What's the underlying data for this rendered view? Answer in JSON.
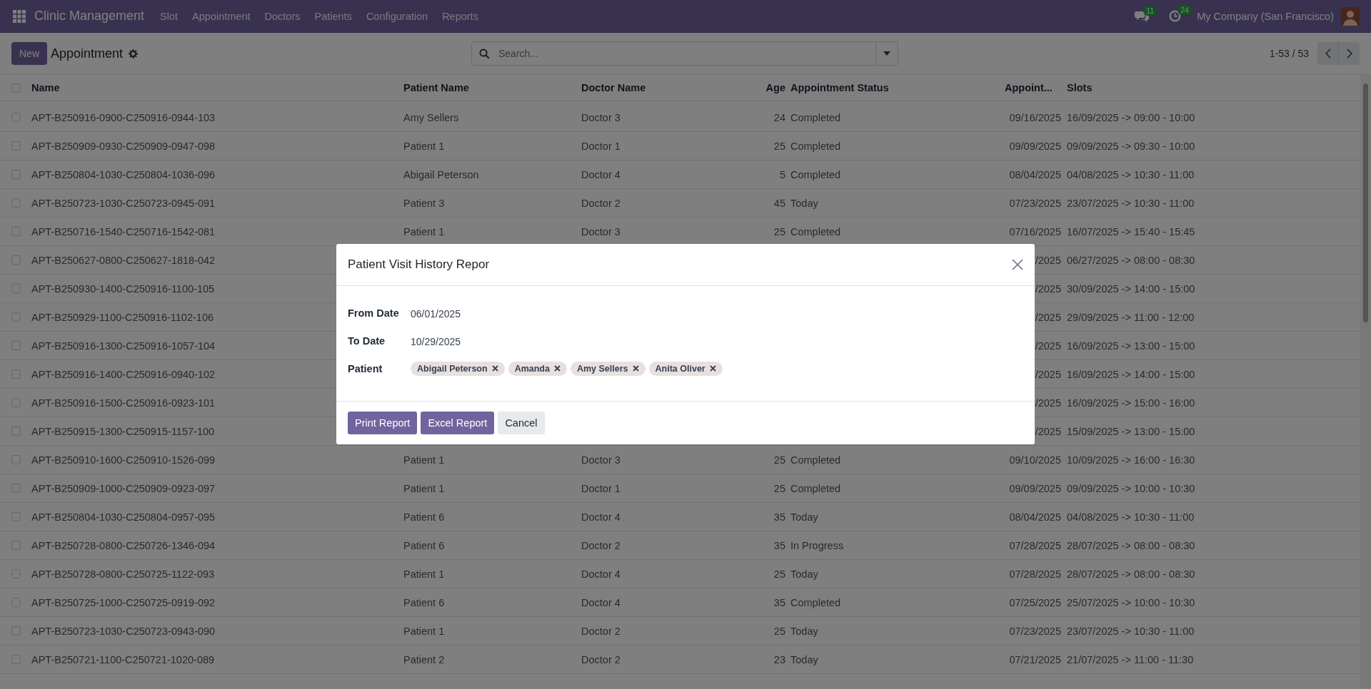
{
  "navbar": {
    "app_name": "Clinic Management",
    "menu": [
      "Slot",
      "Appointment",
      "Doctors",
      "Patients",
      "Configuration",
      "Reports"
    ],
    "messages_count": "11",
    "activities_count": "24",
    "company": "My Company (San Francisco)"
  },
  "control_panel": {
    "new_button": "New",
    "title": "Appointment",
    "search": {
      "placeholder": "Search..."
    },
    "pager": "1-53 / 53"
  },
  "table": {
    "all_selected": false,
    "columns": [
      {
        "label": "Name",
        "kind": "text"
      },
      {
        "label": "Patient Name",
        "kind": "text"
      },
      {
        "label": "Doctor Name",
        "kind": "text"
      },
      {
        "label": "Age",
        "kind": "number"
      },
      {
        "label": "Appointment Status",
        "kind": "text"
      },
      {
        "label": "Appoint...",
        "kind": "date"
      },
      {
        "label": "Slots",
        "kind": "text"
      }
    ],
    "rows": [
      {
        "selected": false,
        "name": "APT-B250916-0900-C250916-0944-103",
        "patient": "Amy Sellers",
        "doctor": "Doctor 3",
        "age": "24",
        "status": "Completed",
        "date": "09/16/2025",
        "slots": "16/09/2025 -> 09:00 - 10:00"
      },
      {
        "selected": false,
        "name": "APT-B250909-0930-C250909-0947-098",
        "patient": "Patient 1",
        "doctor": "Doctor 1",
        "age": "25",
        "status": "Completed",
        "date": "09/09/2025",
        "slots": "09/09/2025 -> 09:30 - 10:00"
      },
      {
        "selected": false,
        "name": "APT-B250804-1030-C250804-1036-096",
        "patient": "Abigail Peterson",
        "doctor": "Doctor 4",
        "age": "5",
        "status": "Completed",
        "date": "08/04/2025",
        "slots": "04/08/2025 -> 10:30 - 11:00"
      },
      {
        "selected": false,
        "name": "APT-B250723-1030-C250723-0945-091",
        "patient": "Patient 3",
        "doctor": "Doctor 2",
        "age": "45",
        "status": "Today",
        "date": "07/23/2025",
        "slots": "23/07/2025 -> 10:30 - 11:00"
      },
      {
        "selected": false,
        "name": "APT-B250716-1540-C250716-1542-081",
        "patient": "Patient 1",
        "doctor": "Doctor 3",
        "age": "25",
        "status": "Completed",
        "date": "07/16/2025",
        "slots": "16/07/2025 -> 15:40 - 15:45"
      },
      {
        "selected": false,
        "name": "APT-B250627-0800-C250627-1818-042",
        "date": "/2025",
        "slots": "06/27/2025 -> 08:00 - 08:30"
      },
      {
        "selected": false,
        "name": "APT-B250930-1400-C250916-1100-105",
        "date": "/2025",
        "slots": "30/09/2025 -> 14:00 - 15:00"
      },
      {
        "selected": false,
        "name": "APT-B250929-1100-C250916-1102-106",
        "date": "/2025",
        "slots": "29/09/2025 -> 11:00 - 12:00"
      },
      {
        "selected": false,
        "name": "APT-B250916-1300-C250916-1057-104",
        "date": "/2025",
        "slots": "16/09/2025 -> 13:00 - 15:00"
      },
      {
        "selected": false,
        "name": "APT-B250916-1400-C250916-0940-102",
        "date": "/2025",
        "slots": "16/09/2025 -> 14:00 - 15:00"
      },
      {
        "selected": false,
        "name": "APT-B250916-1500-C250916-0923-101",
        "date": "/2025",
        "slots": "16/09/2025 -> 15:00 - 16:00"
      },
      {
        "selected": false,
        "name": "APT-B250915-1300-C250915-1157-100",
        "date": "/2025",
        "slots": "15/09/2025 -> 13:00 - 15:00"
      },
      {
        "selected": false,
        "name": "APT-B250910-1600-C250910-1526-099",
        "patient": "Patient 1",
        "doctor": "Doctor 3",
        "age": "25",
        "status": "Completed",
        "date": "09/10/2025",
        "slots": "10/09/2025 -> 16:00 - 16:30"
      },
      {
        "selected": false,
        "name": "APT-B250909-1000-C250909-0923-097",
        "patient": "Patient 1",
        "doctor": "Doctor 1",
        "age": "25",
        "status": "Completed",
        "date": "09/09/2025",
        "slots": "09/09/2025 -> 10:00 - 10:30"
      },
      {
        "selected": false,
        "name": "APT-B250804-1030-C250804-0957-095",
        "patient": "Patient 6",
        "doctor": "Doctor 4",
        "age": "35",
        "status": "Today",
        "date": "08/04/2025",
        "slots": "04/08/2025 -> 10:30 - 11:00"
      },
      {
        "selected": false,
        "name": "APT-B250728-0800-C250726-1346-094",
        "patient": "Patient 6",
        "doctor": "Doctor 2",
        "age": "35",
        "status": "In Progress",
        "date": "07/28/2025",
        "slots": "28/07/2025 -> 08:00 - 08:30"
      },
      {
        "selected": false,
        "name": "APT-B250728-0800-C250725-1122-093",
        "patient": "Patient 1",
        "doctor": "Doctor 4",
        "age": "25",
        "status": "Today",
        "date": "07/28/2025",
        "slots": "28/07/2025 -> 08:00 - 08:30"
      },
      {
        "selected": false,
        "name": "APT-B250725-1000-C250725-0919-092",
        "patient": "Patient 6",
        "doctor": "Doctor 4",
        "age": "35",
        "status": "Completed",
        "date": "07/25/2025",
        "slots": "25/07/2025 -> 10:00 - 10:30"
      },
      {
        "selected": false,
        "name": "APT-B250723-1030-C250723-0943-090",
        "patient": "Patient 1",
        "doctor": "Doctor 2",
        "age": "25",
        "status": "Today",
        "date": "07/23/2025",
        "slots": "23/07/2025 -> 10:30 - 11:00"
      },
      {
        "selected": false,
        "name": "APT-B250721-1100-C250721-1020-089",
        "patient": "Patient 2",
        "doctor": "Doctor 2",
        "age": "23",
        "status": "Today",
        "date": "07/21/2025",
        "slots": "21/07/2025 -> 11:00 - 11:30"
      }
    ]
  },
  "dialog": {
    "title": "Patient Visit History Repor",
    "fields": [
      {
        "label": "From Date",
        "kind": "value",
        "value": "06/01/2025"
      },
      {
        "label": "To Date",
        "kind": "value",
        "value": "10/29/2025"
      },
      {
        "label": "Patient",
        "kind": "tags",
        "tags": [
          "Abigail Peterson",
          "Amanda",
          "Amy Sellers",
          "Anita Oliver"
        ]
      }
    ],
    "buttons": [
      {
        "label": "Print Report",
        "kind": "primary"
      },
      {
        "label": "Excel Report",
        "kind": "primary"
      },
      {
        "label": "Cancel",
        "kind": "secondary"
      }
    ]
  }
}
